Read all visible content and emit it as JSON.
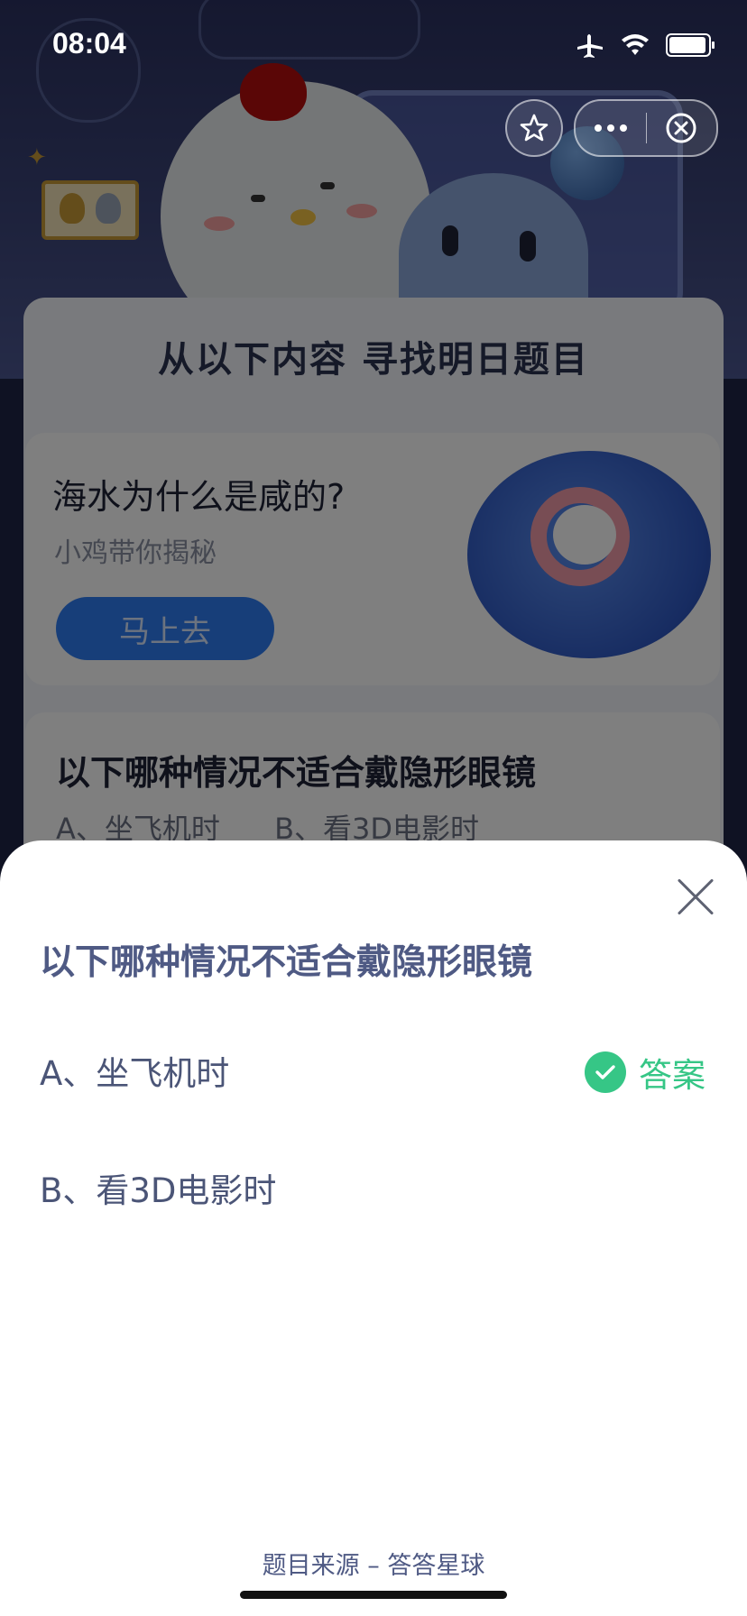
{
  "status_bar": {
    "time": "08:04",
    "battery_level": 0.95
  },
  "capsule": {
    "more_icon": "ellipsis-icon",
    "close_icon": "circle-close-icon",
    "favorite_icon": "star-icon"
  },
  "background": {
    "panel_title": "从以下内容 寻找明日题目",
    "card1": {
      "title": "海水为什么是咸的?",
      "subtitle": "小鸡带你揭秘",
      "button": "马上去"
    },
    "card2": {
      "title": "以下哪种情况不适合戴隐形眼镜",
      "options": [
        "A、坐飞机时",
        "B、看3D电影时"
      ]
    }
  },
  "sheet": {
    "question": "以下哪种情况不适合戴隐形眼镜",
    "options": [
      {
        "label": "A、坐飞机时",
        "is_answer": true
      },
      {
        "label": "B、看3D电影时",
        "is_answer": false
      }
    ],
    "answer_label": "答案",
    "source": "题目来源 – 答答星球"
  },
  "colors": {
    "accent_green": "#36c686",
    "question_text": "#4f5a84",
    "primary_blue": "#2f7df2"
  }
}
